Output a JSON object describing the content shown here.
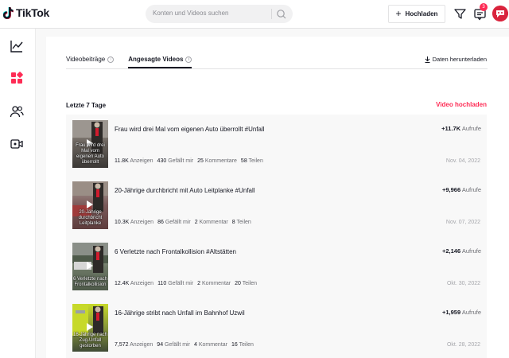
{
  "header": {
    "logo_text": "TikTok",
    "search_placeholder": "Konten und Videos suchen",
    "upload_label": "Hochladen",
    "inbox_badge": "3"
  },
  "tabs": [
    {
      "label": "Videobeiträge",
      "active": false
    },
    {
      "label": "Angesagte Videos",
      "active": true
    }
  ],
  "download_label": "Daten herunterladen",
  "range_label": "Letzte 7 Tage",
  "upload_video_label": "Video hochladen",
  "stat_labels": {
    "views": "Anzeigen",
    "likes": "Gefällt mir",
    "comments": "Kommentar",
    "comments_plural": "Kommentare",
    "shares": "Teilen",
    "aufrufe": "Aufrufe"
  },
  "videos": [
    {
      "title": "Frau wird drei Mal vom eigenen Auto überrollt #Unfall",
      "thumb_caption": "Frau wird drei Mal vom eigenen Auto überrollt",
      "views_delta": "+11.7K",
      "anzeigen": "11.8K",
      "likes": "430",
      "comments": "25",
      "comments_label": "Kommentare",
      "shares": "58",
      "date": "Nov. 04, 2022",
      "thumb_colors": [
        "#6d6660",
        "#9c9690",
        "#3b3835"
      ]
    },
    {
      "title": "20-Jährige durchbricht mit Auto Leitplanke #Unfall",
      "thumb_caption": "20-Jährige durchbricht Leitplanke",
      "views_delta": "+9,966",
      "anzeigen": "10.3K",
      "likes": "86",
      "comments": "2",
      "comments_label": "Kommentar",
      "shares": "8",
      "date": "Nov. 07, 2022",
      "thumb_colors": [
        "#7b5a5a",
        "#9a8e86",
        "#5e3d3d"
      ]
    },
    {
      "title": "6 Verletzte nach Frontalkollision #Altstätten",
      "thumb_caption": "6 Verletzte nach Frontalkollision",
      "views_delta": "+2,146",
      "anzeigen": "12.4K",
      "likes": "110",
      "comments": "2",
      "comments_label": "Kommentar",
      "shares": "20",
      "date": "Okt. 30, 2022",
      "thumb_colors": [
        "#8a8f88",
        "#4e5a4a",
        "#b9bdb4"
      ]
    },
    {
      "title": "16-Jährige stribt nach Unfall im Bahnhof Uzwil",
      "thumb_caption": "16-Jährige nach Zug-Unfall gestorben",
      "views_delta": "+1,959",
      "anzeigen": "7,572",
      "likes": "94",
      "comments": "4",
      "comments_label": "Kommentar",
      "shares": "16",
      "date": "Okt. 28, 2022",
      "thumb_colors": [
        "#c7d92a",
        "#7f8e3a",
        "#3f4a35"
      ]
    }
  ]
}
